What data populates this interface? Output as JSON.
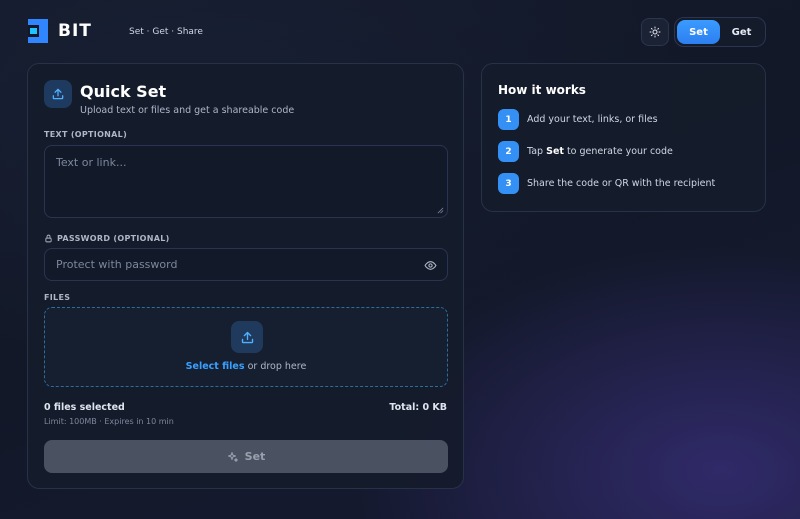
{
  "header": {
    "logo_text": "BIT",
    "tagline": "Set · Get · Share",
    "theme_icon": "sun-icon",
    "mode_set": "Set",
    "mode_get": "Get",
    "active_mode": "Set"
  },
  "quick_set": {
    "title": "Quick Set",
    "subtitle": "Upload text or files and get a shareable code",
    "text_label": "TEXT (OPTIONAL)",
    "text_placeholder": "Text or link...",
    "password_label": "PASSWORD (OPTIONAL)",
    "password_placeholder": "Protect with password",
    "files_label": "FILES",
    "select_files": "Select files",
    "drop_here": "or drop here",
    "files_count": "0 files selected",
    "total": "Total: 0 KB",
    "limit": "Limit: 100MB · Expires in 10 min",
    "set_button": "Set"
  },
  "how_it_works": {
    "title": "How it works",
    "steps": [
      {
        "num": "1",
        "text": "Add your text, links, or files"
      },
      {
        "num": "2",
        "pre": "Tap ",
        "bold": "Set",
        "post": " to generate your code"
      },
      {
        "num": "3",
        "text": "Share the code or QR with the recipient"
      }
    ]
  },
  "colors": {
    "accent": "#3590f5",
    "link": "#3aa0ff",
    "background": "#121827"
  }
}
